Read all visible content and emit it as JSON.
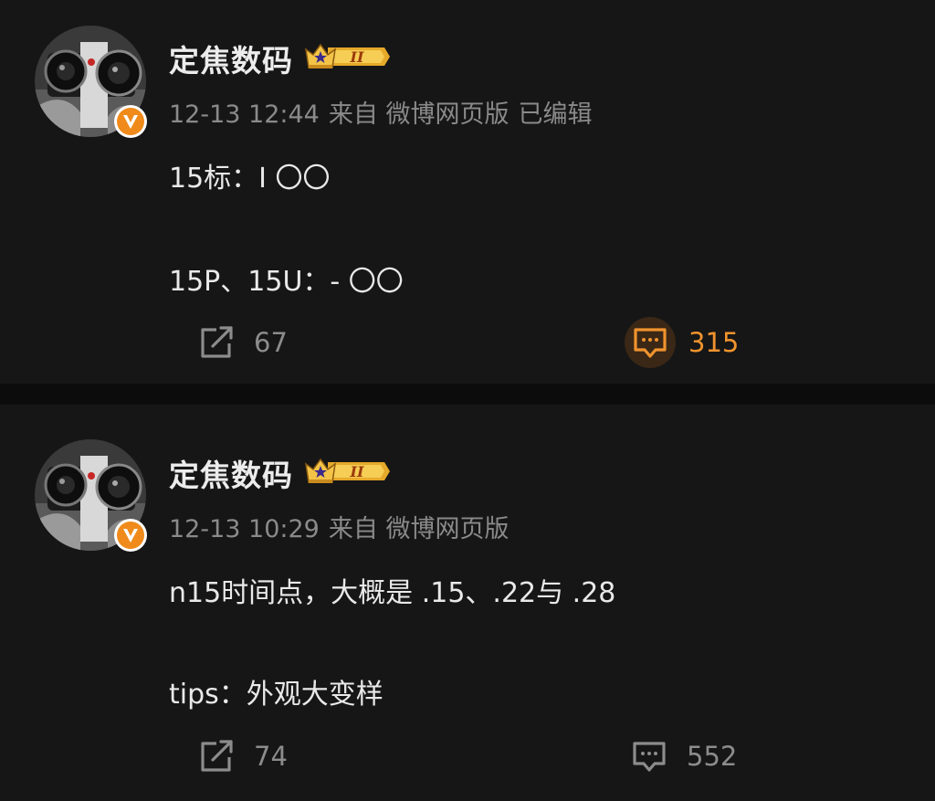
{
  "colors": {
    "background": "#161616",
    "separator": "#0c0c0c",
    "accent": "#f0932e",
    "muted_text": "#8a8a8a",
    "primary_text": "#e9e9e9",
    "verified_badge": "#f08a1a"
  },
  "posts": [
    {
      "author": "定焦数码",
      "badge_text": "II",
      "time": "12-13 12:44",
      "source": "来自 微博网页版",
      "edited": "已编辑",
      "content": [
        "15标：I 〇〇",
        "15P、15U：- 〇〇"
      ],
      "repost_count": "67",
      "comment_count": "315",
      "icons": {
        "repost": "share-icon",
        "comment": "comment-icon",
        "verified": "verified-v-icon",
        "member": "crown-icon"
      }
    },
    {
      "author": "定焦数码",
      "badge_text": "II",
      "time": "12-13 10:29",
      "source": "来自 微博网页版",
      "content": [
        "n15时间点，大概是 .15、.22与 .28",
        "tips：外观大变样"
      ],
      "repost_count": "74",
      "comment_count": "552",
      "icons": {
        "repost": "share-icon",
        "comment": "comment-icon",
        "verified": "verified-v-icon",
        "member": "crown-icon"
      }
    }
  ]
}
